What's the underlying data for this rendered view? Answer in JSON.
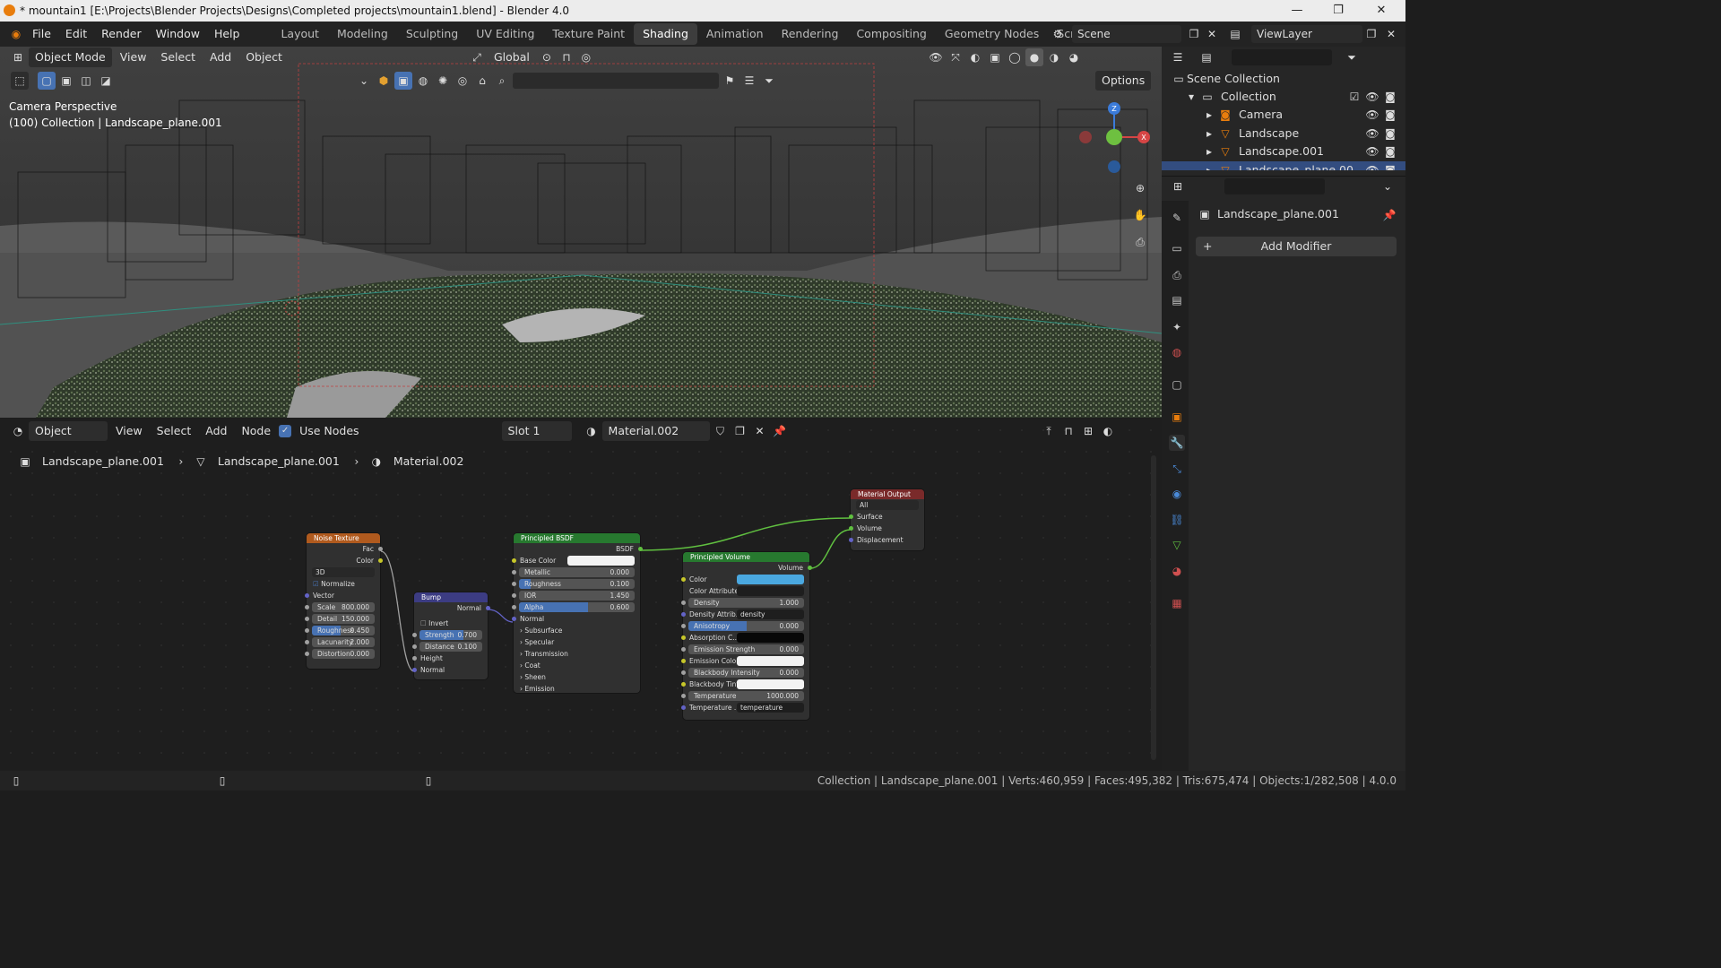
{
  "window": {
    "title": "* mountain1 [E:\\Projects\\Blender Projects\\Designs\\Completed projects\\mountain1.blend] - Blender 4.0",
    "minimize": "—",
    "maximize": "❐",
    "close": "✕"
  },
  "menus": [
    "File",
    "Edit",
    "Render",
    "Window",
    "Help"
  ],
  "workspaces": [
    "Layout",
    "Modeling",
    "Sculpting",
    "UV Editing",
    "Texture Paint",
    "Shading",
    "Animation",
    "Rendering",
    "Compositing",
    "Geometry Nodes",
    "Scripting"
  ],
  "active_workspace": "Shading",
  "scene": "Scene",
  "view_layer": "ViewLayer",
  "viewport": {
    "mode": "Object Mode",
    "menus": [
      "View",
      "Select",
      "Add",
      "Object"
    ],
    "transform": "Global",
    "options": "Options",
    "info1": "Camera Perspective",
    "info2": "(100) Collection | Landscape_plane.001",
    "gizmo": {
      "z": "Z",
      "x": "X"
    }
  },
  "node_editor": {
    "type": "Object",
    "menus": [
      "View",
      "Select",
      "Add",
      "Node"
    ],
    "use_nodes": "Use Nodes",
    "slot": "Slot 1",
    "material": "Material.002",
    "breadcrumb": [
      "Landscape_plane.001",
      "Landscape_plane.001",
      "Material.002"
    ]
  },
  "nodes": {
    "noise": {
      "title": "Noise Texture",
      "fac": "Fac",
      "color": "Color",
      "dim": "3D",
      "normalize": "Normalize",
      "vector": "Vector",
      "fields": [
        {
          "label": "Scale",
          "value": "800.000"
        },
        {
          "label": "Detail",
          "value": "150.000"
        },
        {
          "label": "Roughness",
          "value": "0.450",
          "fill": 0.45
        },
        {
          "label": "Lacunarity",
          "value": "2.000"
        },
        {
          "label": "Distortion",
          "value": "0.000"
        }
      ]
    },
    "bump": {
      "title": "Bump",
      "normal_out": "Normal",
      "invert": "Invert",
      "height": "Height",
      "normal": "Normal",
      "fields": [
        {
          "label": "Strength",
          "value": "0.700",
          "fill": 0.7
        },
        {
          "label": "Distance",
          "value": "0.100"
        }
      ]
    },
    "bsdf": {
      "title": "Principled BSDF",
      "out": "BSDF",
      "base_color": "Base Color",
      "normal": "Normal",
      "fields": [
        {
          "label": "Metallic",
          "value": "0.000",
          "fill": 0
        },
        {
          "label": "Roughness",
          "value": "0.100",
          "fill": 0.1
        },
        {
          "label": "IOR",
          "value": "1.450"
        },
        {
          "label": "Alpha",
          "value": "0.600",
          "fill": 0.6
        }
      ],
      "panels": [
        "Subsurface",
        "Specular",
        "Transmission",
        "Coat",
        "Sheen",
        "Emission"
      ]
    },
    "volume": {
      "title": "Principled Volume",
      "out": "Volume",
      "color": "Color",
      "color_attr": "Color Attribute",
      "density_attr": "Density Attrib...",
      "density_attr_val": "density",
      "absorption": "Absorption C...",
      "emission_color": "Emission Color",
      "blackbody_tint": "Blackbody Tint",
      "temp_attr": "Temperature ...",
      "temp_attr_val": "temperature",
      "fields": [
        {
          "label": "Density",
          "value": "1.000"
        },
        {
          "label": "Anisotropy",
          "value": "0.000",
          "fill": 0.5
        },
        {
          "label": "Emission Strength",
          "value": "0.000"
        },
        {
          "label": "Blackbody Intensity",
          "value": "0.000"
        },
        {
          "label": "Temperature",
          "value": "1000.000"
        }
      ]
    },
    "output": {
      "title": "Material Output",
      "target": "All",
      "surface": "Surface",
      "volume": "Volume",
      "displacement": "Displacement"
    }
  },
  "outliner": {
    "root": "Scene Collection",
    "collection": "Collection",
    "items": [
      "Camera",
      "Landscape",
      "Landscape.001",
      "Landscape_plane.00"
    ]
  },
  "properties": {
    "object": "Landscape_plane.001",
    "add_modifier": "Add Modifier"
  },
  "status": "Collection | Landscape_plane.001 | Verts:460,959 | Faces:495,382 | Tris:675,474 | Objects:1/282,508 | 4.0.0",
  "colors": {
    "accent": "#4772b3",
    "active_tab": "#3d3d3d",
    "noise_header": "#b05a1e",
    "bump_header": "#3c3c83",
    "shader_header": "#27792f",
    "output_header": "#7a2a2a",
    "link": "#60c040"
  }
}
